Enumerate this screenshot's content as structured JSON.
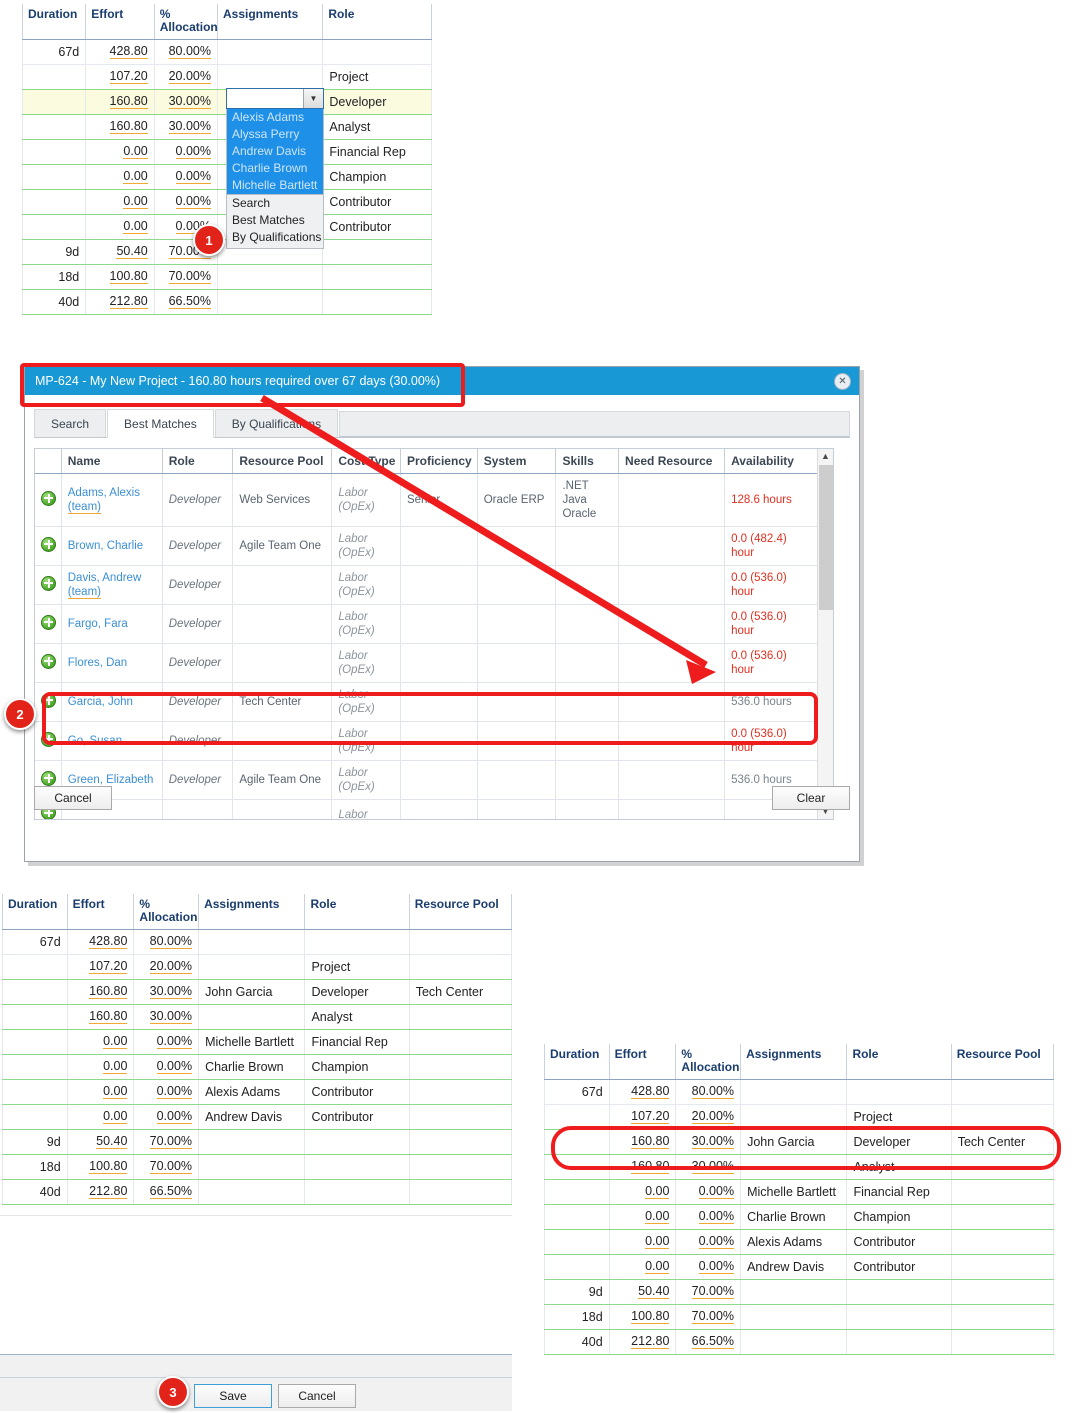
{
  "grid_headers": [
    "Duration",
    "Effort",
    "% Allocation",
    "Assignments",
    "Role",
    "Resource Pool"
  ],
  "top_grid": {
    "headers": [
      "Duration",
      "Effort",
      "% Allocation",
      "Assignments",
      "Role"
    ],
    "rows": [
      {
        "duration": "67d",
        "effort": "428.80",
        "alloc": "80.00%",
        "assignment": "",
        "role": ""
      },
      {
        "duration": "",
        "effort": "107.20",
        "alloc": "20.00%",
        "assignment": "",
        "role": "Project"
      },
      {
        "duration": "",
        "effort": "160.80",
        "alloc": "30.00%",
        "assignment": "",
        "role": "Developer",
        "highlight": true
      },
      {
        "duration": "",
        "effort": "160.80",
        "alloc": "30.00%",
        "assignment": "",
        "role": "Analyst"
      },
      {
        "duration": "",
        "effort": "0.00",
        "alloc": "0.00%",
        "assignment": "",
        "role": "Financial Rep"
      },
      {
        "duration": "",
        "effort": "0.00",
        "alloc": "0.00%",
        "assignment": "",
        "role": "Champion"
      },
      {
        "duration": "",
        "effort": "0.00",
        "alloc": "0.00%",
        "assignment": "",
        "role": "Contributor"
      },
      {
        "duration": "",
        "effort": "0.00",
        "alloc": "0.00%",
        "assignment": "",
        "role": "Contributor"
      },
      {
        "duration": "9d",
        "effort": "50.40",
        "alloc": "70.00%",
        "assignment": "",
        "role": ""
      },
      {
        "duration": "18d",
        "effort": "100.80",
        "alloc": "70.00%",
        "assignment": "",
        "role": ""
      },
      {
        "duration": "40d",
        "effort": "212.80",
        "alloc": "66.50%",
        "assignment": "",
        "role": ""
      }
    ]
  },
  "dropdown": {
    "value": "",
    "placeholder": "",
    "arrow_icon": "chevron-down-icon",
    "people": [
      "Alexis Adams",
      "Alyssa Perry",
      "Andrew Davis",
      "Charlie Brown",
      "Michelle Bartlett"
    ],
    "actions": [
      "Search",
      "Best Matches",
      "By Qualifications"
    ]
  },
  "dialog": {
    "title": "MP-624 - My New Project - 160.80 hours required over 67 days (30.00%)",
    "close_icon": "close-icon",
    "tabs": [
      {
        "label": "Search",
        "active": false
      },
      {
        "label": "Best Matches",
        "active": true
      },
      {
        "label": "By Qualifications",
        "active": false
      }
    ],
    "table": {
      "headers": [
        "",
        "Name",
        "Role",
        "Resource Pool",
        "Cost Type",
        "Proficiency",
        "System",
        "Skills",
        "Need Resource",
        "Availability"
      ],
      "rows": [
        {
          "add_icon": "add-circle-icon",
          "name": "Adams, Alexis",
          "team": "(team)",
          "role": "Developer",
          "pool": "Web Services",
          "cost": "Labor (OpEx)",
          "proficiency": "Senior",
          "system": "Oracle ERP",
          "skills": ".NET Java Oracle",
          "need": "",
          "availability": "128.6 hours",
          "avail_style": "red"
        },
        {
          "add_icon": "add-circle-icon",
          "name": "Brown, Charlie",
          "team": "",
          "role": "Developer",
          "pool": "Agile Team One",
          "cost": "Labor (OpEx)",
          "proficiency": "",
          "system": "",
          "skills": "",
          "need": "",
          "availability": "0.0 (482.4) hour",
          "avail_style": "red"
        },
        {
          "add_icon": "add-circle-icon",
          "name": "Davis, Andrew",
          "team": "(team)",
          "role": "Developer",
          "pool": "",
          "cost": "Labor (OpEx)",
          "proficiency": "",
          "system": "",
          "skills": "",
          "need": "",
          "availability": "0.0 (536.0) hour",
          "avail_style": "red"
        },
        {
          "add_icon": "add-circle-icon",
          "name": "Fargo, Fara",
          "team": "",
          "role": "Developer",
          "pool": "",
          "cost": "Labor (OpEx)",
          "proficiency": "",
          "system": "",
          "skills": "",
          "need": "",
          "availability": "0.0 (536.0) hour",
          "avail_style": "red"
        },
        {
          "add_icon": "add-circle-icon",
          "name": "Flores, Dan",
          "team": "",
          "role": "Developer",
          "pool": "",
          "cost": "Labor (OpEx)",
          "proficiency": "",
          "system": "",
          "skills": "",
          "need": "",
          "availability": "0.0 (536.0) hour",
          "avail_style": "red"
        },
        {
          "add_icon": "add-circle-icon",
          "name": "Garcia, John",
          "team": "",
          "role": "Developer",
          "pool": "Tech Center",
          "cost": "Labor (OpEx)",
          "proficiency": "",
          "system": "",
          "skills": "",
          "need": "",
          "availability": "536.0 hours",
          "avail_style": "gray"
        },
        {
          "add_icon": "add-circle-icon",
          "name": "Go, Susan",
          "team": "",
          "role": "Developer",
          "pool": "",
          "cost": "Labor (OpEx)",
          "proficiency": "",
          "system": "",
          "skills": "",
          "need": "",
          "availability": "0.0 (536.0) hour",
          "avail_style": "red"
        },
        {
          "add_icon": "add-circle-icon",
          "name": "Green, Elizabeth",
          "team": "",
          "role": "Developer",
          "pool": "Agile Team One",
          "cost": "Labor (OpEx)",
          "proficiency": "",
          "system": "",
          "skills": "",
          "need": "",
          "availability": "536.0 hours",
          "avail_style": "gray"
        },
        {
          "add_icon": "add-circle-icon",
          "name": "",
          "team": "",
          "role": "",
          "pool": "",
          "cost": "Labor",
          "proficiency": "",
          "system": "",
          "skills": "",
          "need": "",
          "availability": "",
          "avail_style": "gray"
        }
      ]
    },
    "cancel_label": "Cancel",
    "clear_label": "Clear",
    "scrollbar": {
      "up_icon": "chevron-up-icon",
      "down_icon": "chevron-down-icon"
    }
  },
  "bottom_left_grid": {
    "headers": [
      "Duration",
      "Effort",
      "% Allocation",
      "Assignments",
      "Role",
      "Resource Pool"
    ],
    "rows": [
      {
        "duration": "67d",
        "effort": "428.80",
        "alloc": "80.00%",
        "assignment": "",
        "role": "",
        "pool": ""
      },
      {
        "duration": "",
        "effort": "107.20",
        "alloc": "20.00%",
        "assignment": "",
        "role": "Project",
        "pool": ""
      },
      {
        "duration": "",
        "effort": "160.80",
        "alloc": "30.00%",
        "assignment": "John Garcia",
        "role": "Developer",
        "pool": "Tech Center"
      },
      {
        "duration": "",
        "effort": "160.80",
        "alloc": "30.00%",
        "assignment": "",
        "role": "Analyst",
        "pool": ""
      },
      {
        "duration": "",
        "effort": "0.00",
        "alloc": "0.00%",
        "assignment": "Michelle Bartlett",
        "role": "Financial Rep",
        "pool": ""
      },
      {
        "duration": "",
        "effort": "0.00",
        "alloc": "0.00%",
        "assignment": "Charlie Brown",
        "role": "Champion",
        "pool": ""
      },
      {
        "duration": "",
        "effort": "0.00",
        "alloc": "0.00%",
        "assignment": "Alexis Adams",
        "role": "Contributor",
        "pool": ""
      },
      {
        "duration": "",
        "effort": "0.00",
        "alloc": "0.00%",
        "assignment": "Andrew Davis",
        "role": "Contributor",
        "pool": ""
      },
      {
        "duration": "9d",
        "effort": "50.40",
        "alloc": "70.00%",
        "assignment": "",
        "role": "",
        "pool": ""
      },
      {
        "duration": "18d",
        "effort": "100.80",
        "alloc": "70.00%",
        "assignment": "",
        "role": "",
        "pool": ""
      },
      {
        "duration": "40d",
        "effort": "212.80",
        "alloc": "66.50%",
        "assignment": "",
        "role": "",
        "pool": ""
      }
    ]
  },
  "bottom_right_grid": {
    "headers": [
      "Duration",
      "Effort",
      "% Allocation",
      "Assignments",
      "Role",
      "Resource Pool"
    ],
    "rows": [
      {
        "duration": "67d",
        "effort": "428.80",
        "alloc": "80.00%",
        "assignment": "",
        "role": "",
        "pool": ""
      },
      {
        "duration": "",
        "effort": "107.20",
        "alloc": "20.00%",
        "assignment": "",
        "role": "Project",
        "pool": ""
      },
      {
        "duration": "",
        "effort": "160.80",
        "alloc": "30.00%",
        "assignment": "John Garcia",
        "role": "Developer",
        "pool": "Tech Center"
      },
      {
        "duration": "",
        "effort": "160.80",
        "alloc": "30.00%",
        "assignment": "",
        "role": "Analyst",
        "pool": ""
      },
      {
        "duration": "",
        "effort": "0.00",
        "alloc": "0.00%",
        "assignment": "Michelle Bartlett",
        "role": "Financial Rep",
        "pool": ""
      },
      {
        "duration": "",
        "effort": "0.00",
        "alloc": "0.00%",
        "assignment": "Charlie Brown",
        "role": "Champion",
        "pool": ""
      },
      {
        "duration": "",
        "effort": "0.00",
        "alloc": "0.00%",
        "assignment": "Alexis Adams",
        "role": "Contributor",
        "pool": ""
      },
      {
        "duration": "",
        "effort": "0.00",
        "alloc": "0.00%",
        "assignment": "Andrew Davis",
        "role": "Contributor",
        "pool": ""
      },
      {
        "duration": "9d",
        "effort": "50.40",
        "alloc": "70.00%",
        "assignment": "",
        "role": "",
        "pool": ""
      },
      {
        "duration": "18d",
        "effort": "100.80",
        "alloc": "70.00%",
        "assignment": "",
        "role": "",
        "pool": ""
      },
      {
        "duration": "40d",
        "effort": "212.80",
        "alloc": "66.50%",
        "assignment": "",
        "role": "",
        "pool": ""
      }
    ]
  },
  "form_bar": {
    "save_label": "Save",
    "cancel_label": "Cancel"
  },
  "annotations": {
    "badges": [
      "1",
      "2",
      "3"
    ],
    "accent_red": "#ee1c1c",
    "title_blue": "#1899d6",
    "header_navy": "#1a3d6d",
    "row_green": "#8ed88e",
    "underline_amber": "#f0a830"
  }
}
